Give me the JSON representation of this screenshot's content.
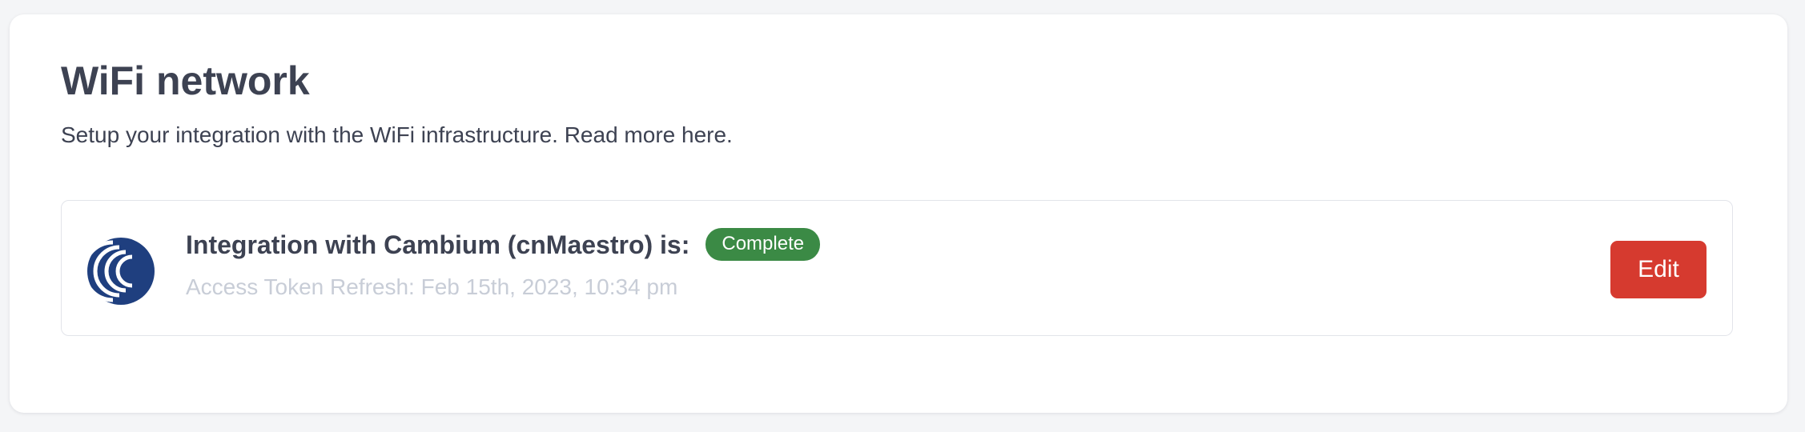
{
  "section": {
    "title": "WiFi network",
    "description": "Setup your integration with the WiFi infrastructure. Read more here."
  },
  "integration": {
    "logo_icon": "cambium-logo-icon",
    "heading": "Integration with Cambium (cnMaestro) is:",
    "status": "Complete",
    "token_refresh": "Access Token Refresh: Feb 15th, 2023, 10:34 pm",
    "edit_label": "Edit"
  },
  "colors": {
    "status_complete": "#3b8a45",
    "edit_button": "#d63a2f",
    "logo_blue": "#1f3f7f"
  }
}
